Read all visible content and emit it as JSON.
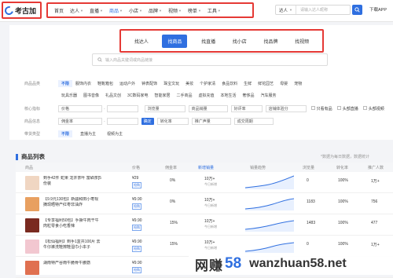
{
  "logo": {
    "text": "考古加"
  },
  "nav": {
    "items": [
      {
        "label": "首页",
        "caret": false,
        "active": false
      },
      {
        "label": "达人",
        "caret": true,
        "active": false
      },
      {
        "label": "直播",
        "caret": true,
        "active": false
      },
      {
        "label": "商品",
        "caret": true,
        "active": true
      },
      {
        "label": "小店",
        "caret": true,
        "active": false
      },
      {
        "label": "品牌",
        "caret": true,
        "active": false
      },
      {
        "label": "视频",
        "caret": true,
        "active": false
      },
      {
        "label": "榜单",
        "caret": true,
        "active": false
      },
      {
        "label": "工具",
        "caret": true,
        "active": false
      }
    ]
  },
  "top_search": {
    "select": "达人",
    "placeholder": "请输入达人昵称"
  },
  "app_link": "下载APP",
  "tabs": [
    {
      "label": "找达人",
      "active": false
    },
    {
      "label": "找商品",
      "active": true
    },
    {
      "label": "找直播",
      "active": false
    },
    {
      "label": "找小店",
      "active": false
    },
    {
      "label": "找品牌",
      "active": false
    },
    {
      "label": "找视频",
      "active": false
    }
  ],
  "main_search": {
    "placeholder": "输入商品关键词或商品链接"
  },
  "filters": {
    "category": {
      "label": "商品品类",
      "options": [
        "不限",
        "服饰内衣",
        "鞋靴箱包",
        "运动户外",
        "钟表配饰",
        "珠宝文玩",
        "美妆",
        "个护家清",
        "食品饮料",
        "生鲜",
        "鲜花园艺",
        "母婴",
        "宠物"
      ],
      "options2": [
        "玩具乐器",
        "图书音像",
        "礼品文创",
        "3C数码家电",
        "智能家居",
        "二手商品",
        "虚拟充值",
        "本地生活",
        "奢侈品",
        "汽车服务"
      ]
    },
    "core": {
      "label": "核心指标",
      "price": "价格",
      "browse": "浏览量",
      "sales": "商品销量",
      "rate": "好评率",
      "exp": "店铺体验分",
      "only_buy": "只看有品",
      "ad_buy": "头部直播",
      "ad_video": "头部视频"
    },
    "extra": {
      "label": "商品信息",
      "commission": "佣金率",
      "confirm": "确定",
      "conversion": "转化率",
      "promote": "推广声量",
      "trade": "成交周期"
    },
    "type": {
      "label": "带货类型",
      "options": [
        "不限",
        "直播为主",
        "视频为主"
      ]
    }
  },
  "list": {
    "title": "商品列表",
    "tip": "*数据为每日数据，数据统计",
    "columns": [
      "商品",
      "价格",
      "佣金率",
      "新增销量",
      "销量趋势",
      "浏览量",
      "转化率",
      "推广人数"
    ],
    "rows": [
      {
        "name": "到手42件 蛇果 龙井茶叶 富硒茶[5份装",
        "price": "¥29",
        "badge": "抢购",
        "commission": "0%",
        "sales": "10万+",
        "sales_sub": "今日新增",
        "browse": "0",
        "conversion": "100%",
        "people": "1万+"
      },
      {
        "name": "【9.9元130包】新疆和田小枣现摘现晒特产红枣非油炸",
        "price": "¥9.90",
        "badge": "抢购",
        "commission": "0%",
        "sales": "10万+",
        "sales_sub": "今日新增",
        "browse": "1183",
        "conversion": "100%",
        "people": "756"
      },
      {
        "name": "【专享福利50包】手撕牛肉干牛肉粒零食小吃香辣",
        "price": "¥9.90",
        "badge": "抢购",
        "commission": "15%",
        "sales": "10万+",
        "sales_sub": "今日新增",
        "browse": "1483",
        "conversion": "100%",
        "people": "477"
      },
      {
        "name": "【松仙福利】到手1盒共100片 去牛仔裤洗鞋擦鞋湿巾小本子",
        "price": "¥9.90",
        "badge": "抢购",
        "commission": "15%",
        "sales": "10万+",
        "sales_sub": "今日新增",
        "browse": "0",
        "conversion": "100%",
        "people": "1万+"
      },
      {
        "name": "湖南特产谷雨牛脆骨牛腰筋",
        "price": "¥9.90",
        "badge": "抢购",
        "commission": "",
        "sales": "",
        "sales_sub": "",
        "browse": "",
        "conversion": "",
        "people": ""
      }
    ]
  },
  "watermark": {
    "cn": "网赚",
    "num": "58",
    "url": "wanzhuan58.net"
  },
  "colors": {
    "accent": "#2f6fe0",
    "highlight_border": "#e53935"
  }
}
